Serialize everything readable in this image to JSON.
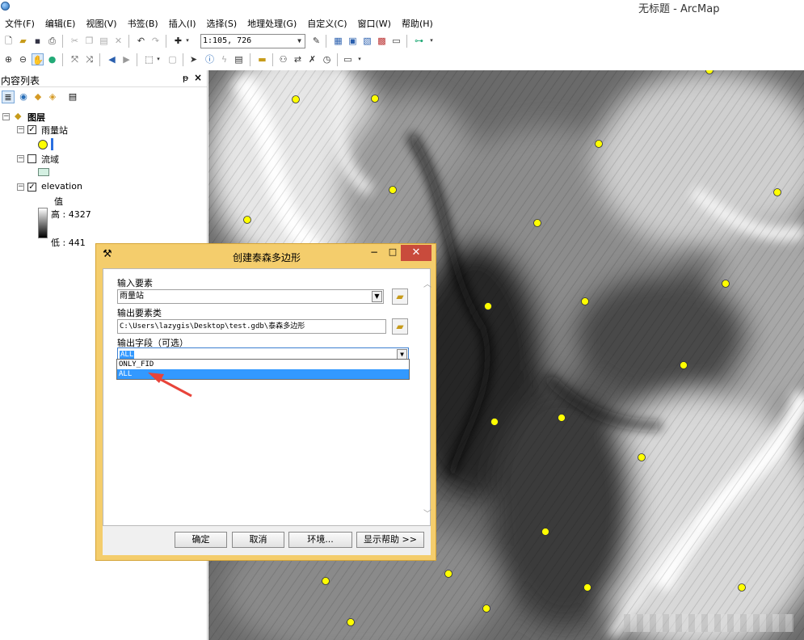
{
  "window": {
    "title": "无标题 - ArcMap"
  },
  "menu": [
    "文件(F)",
    "编辑(E)",
    "视图(V)",
    "书签(B)",
    "插入(I)",
    "选择(S)",
    "地理处理(G)",
    "自定义(C)",
    "窗口(W)",
    "帮助(H)"
  ],
  "toolbar": {
    "scale": "1:105, 726"
  },
  "toc": {
    "title": "内容列表",
    "pin": "ᵽ",
    "close": "×",
    "layers_root": "图层",
    "layers": [
      {
        "name": "雨量站",
        "checked": true
      },
      {
        "name": "流域",
        "checked": false
      },
      {
        "name": "elevation",
        "checked": true
      }
    ],
    "elevation_legend": {
      "value_label": "值",
      "high": "高 : 4327",
      "low": "低 : 441"
    }
  },
  "dialog": {
    "title": "创建泰森多边形",
    "input_label": "输入要素",
    "input_value": "雨量站",
    "output_label": "输出要素类",
    "output_value": "C:\\Users\\lazygis\\Desktop\\test.gdb\\泰森多边形",
    "field_label": "输出字段（可选）",
    "field_value": "ALL",
    "field_options": [
      "ONLY_FID",
      "ALL"
    ],
    "selected_option": "ALL",
    "buttons": {
      "ok": "确定",
      "cancel": "取消",
      "env": "环境...",
      "help": "显示帮助 >>"
    }
  },
  "colors": {
    "point": "#ffff00",
    "dialog_frame": "#f4cd6c",
    "selection": "#3399ff",
    "annotation": "#e8443a"
  }
}
